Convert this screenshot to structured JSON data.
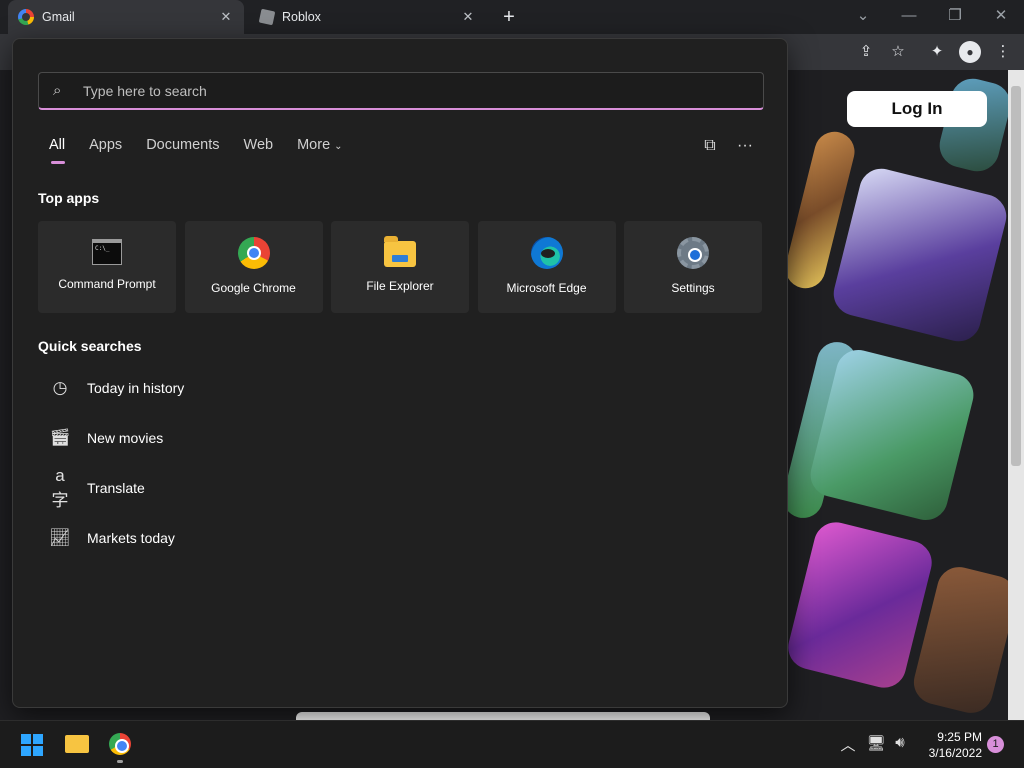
{
  "browser": {
    "tabs": [
      {
        "title": "Gmail",
        "icon": "gmail-favicon-icon",
        "active": true
      },
      {
        "title": "Roblox",
        "icon": "roblox-favicon-icon",
        "active": false
      }
    ],
    "new_tab_symbol": "+",
    "tab_close_symbol": "✕"
  },
  "page": {
    "login_label": "Log In"
  },
  "search_panel": {
    "placeholder": "Type here to search",
    "filters": [
      "All",
      "Apps",
      "Documents",
      "Web",
      "More"
    ],
    "active_filter": "All",
    "top_apps_title": "Top apps",
    "top_apps": [
      {
        "label": "Command Prompt",
        "icon": "command-prompt-icon"
      },
      {
        "label": "Google Chrome",
        "icon": "chrome-icon"
      },
      {
        "label": "File Explorer",
        "icon": "file-explorer-icon"
      },
      {
        "label": "Microsoft Edge",
        "icon": "edge-icon"
      },
      {
        "label": "Settings",
        "icon": "settings-gear-icon"
      }
    ],
    "quick_searches_title": "Quick searches",
    "quick_searches": [
      {
        "label": "Today in history",
        "icon": "clock-icon"
      },
      {
        "label": "New movies",
        "icon": "clapperboard-icon"
      },
      {
        "label": "Translate",
        "icon": "translate-icon"
      },
      {
        "label": "Markets today",
        "icon": "chart-icon"
      }
    ]
  },
  "taskbar": {
    "time": "9:25 PM",
    "date": "3/16/2022",
    "notification_count": "1"
  },
  "colors": {
    "accent": "#d88fd9",
    "panel_bg": "#202020",
    "tile_bg": "#2b2b2b"
  }
}
